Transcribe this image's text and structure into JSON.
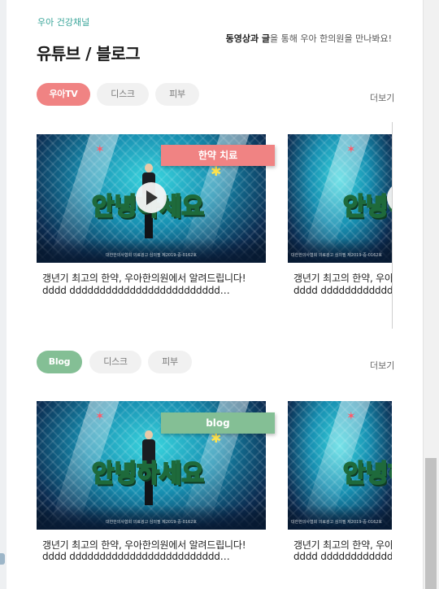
{
  "section": {
    "eyebrow": "우아 건강채널",
    "title": "유튜브 / 블로그",
    "desc_bold": "동영상과 글",
    "desc_rest": "을 통해 우아 한의원을 만나봐요!"
  },
  "youtube": {
    "tabs": [
      "우아TV",
      "디스크",
      "피부"
    ],
    "more": "더보기",
    "ribbon": "한약 치료",
    "thumb_text": "안녕하세요",
    "thumb_caption": "대한한의사협회 의료광고 심의필 제2019-중-0162호",
    "cards": [
      {
        "title": "갱년기 최고의 한약, 우아한의원에서 알려드립니다!",
        "sub": "dddd ddddddddddddddddddddddddd…"
      },
      {
        "title": "갱년기 최고의 한약, 우아한의원에서 알려드립니다!",
        "sub": "dddd ddddddddddddddddddddddddd…"
      }
    ]
  },
  "blog": {
    "tabs": [
      "Blog",
      "디스크",
      "피부"
    ],
    "more": "더보기",
    "ribbon": "blog",
    "thumb_text": "안녕하세요",
    "thumb_caption": "대한한의사협회 의료광고 심의필 제2019-중-0162호",
    "cards": [
      {
        "title": "갱년기 최고의 한약, 우아한의원에서 알려드립니다!",
        "sub": "dddd ddddddddddddddddddddddddd…"
      },
      {
        "title": "갱년기 최고의 한약, 우아한의원에서 알려드립니다!",
        "sub": "dddd ddddddddddddddddddddddddd…"
      }
    ]
  },
  "colors": {
    "accent_teal": "#3aa59a",
    "youtube_red": "#f08383",
    "blog_green": "#84bf95"
  },
  "icons": [
    "play-icon"
  ]
}
